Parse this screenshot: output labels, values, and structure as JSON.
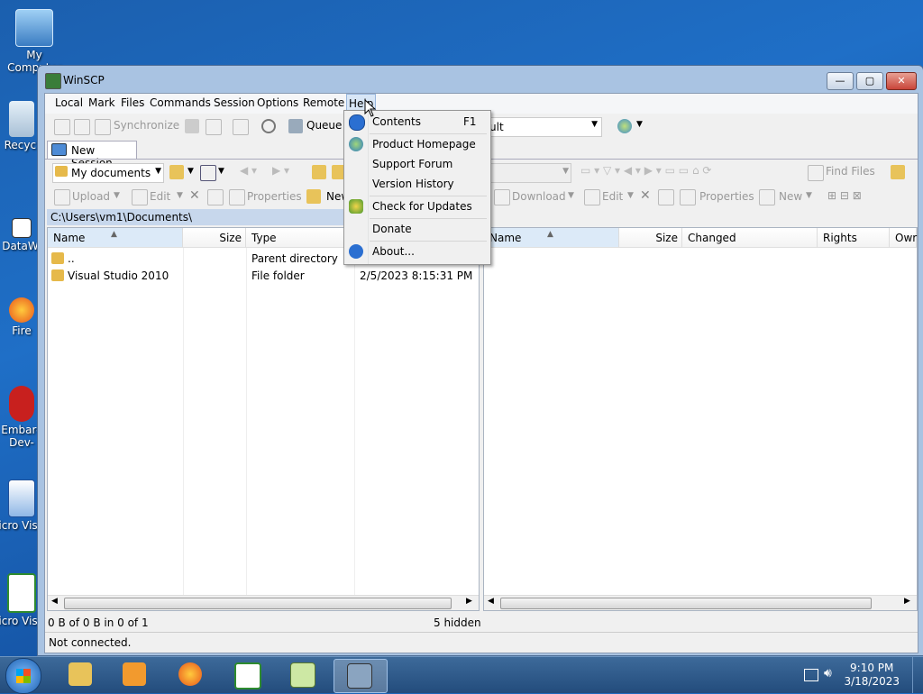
{
  "desktop": {
    "icons": [
      {
        "label": "My Computer"
      },
      {
        "label": "Recycl"
      },
      {
        "label": "DataWi"
      },
      {
        "label": "Fire"
      },
      {
        "label": "Embarc Dev-"
      },
      {
        "label": "Micro Visual"
      },
      {
        "label": "Micro Visual"
      }
    ]
  },
  "window": {
    "title": "WinSCP",
    "controls": {
      "min": "—",
      "max": "▢",
      "close": "✕"
    },
    "close_color": "#c9453a"
  },
  "menubar": [
    "Local",
    "Mark",
    "Files",
    "Commands",
    "Session",
    "Options",
    "Remote",
    "Help"
  ],
  "toolbar1": {
    "synchronize": "Synchronize",
    "queue": "Queue",
    "session_combo": "ult"
  },
  "tabs": {
    "new_session": "New Session"
  },
  "left": {
    "location": "My documents",
    "upload": "Upload",
    "edit": "Edit",
    "properties": "Properties",
    "new": "New",
    "path": "C:\\Users\\vm1\\Documents\\",
    "columns": {
      "name": "Name",
      "size": "Size",
      "type": "Type"
    },
    "rows": [
      {
        "name": "..",
        "type": "Parent directory",
        "changed": ""
      },
      {
        "name": "Visual Studio 2010",
        "type": "File folder",
        "changed": "2/5/2023  8:15:31 PM"
      }
    ],
    "status": "0 B of 0 B in 0 of 1",
    "hidden": "5 hidden"
  },
  "right": {
    "find_files": "Find Files",
    "download": "Download",
    "edit": "Edit",
    "properties": "Properties",
    "new": "New",
    "columns": {
      "name": "Name",
      "size": "Size",
      "changed": "Changed",
      "rights": "Rights",
      "owner": "Owr"
    }
  },
  "statusbar": {
    "text": "Not connected."
  },
  "help_menu": {
    "items": [
      {
        "label": "Contents",
        "shortcut": "F1"
      },
      {
        "label": "Product Homepage"
      },
      {
        "label": "Support Forum"
      },
      {
        "label": "Version History"
      },
      {
        "label": "Check for Updates"
      },
      {
        "label": "Donate"
      },
      {
        "label": "About..."
      }
    ]
  },
  "taskbar": {
    "time": "9:10 PM",
    "date": "3/18/2023",
    "apps": [
      "start-orb",
      "explorer",
      "media-player",
      "firefox",
      "csharp-ide",
      "notepad-plus",
      "winscp"
    ]
  }
}
